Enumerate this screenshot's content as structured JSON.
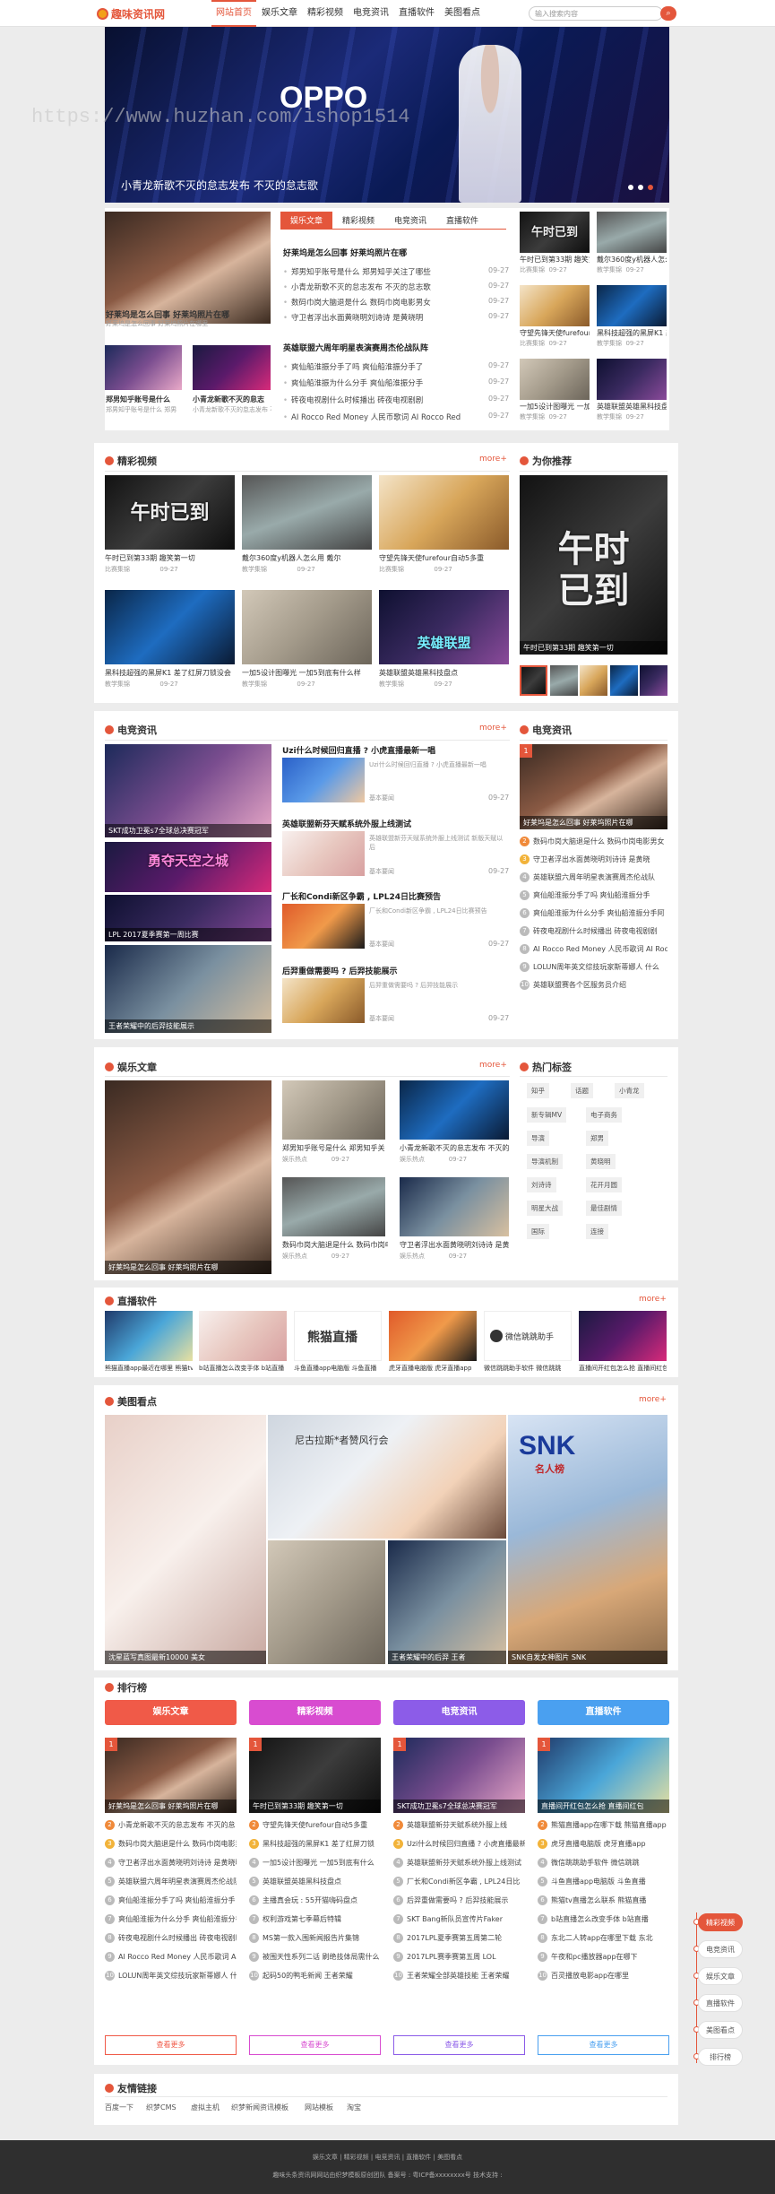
{
  "header": {
    "logo": "趣味资讯网",
    "nav": [
      "网站首页",
      "娱乐文章",
      "精彩视频",
      "电竞资讯",
      "直播软件",
      "美图看点"
    ],
    "search_placeholder": "输入搜索内容"
  },
  "banner": {
    "brand": "OPPO",
    "caption": "小青龙新歌不灭的怠志发布 不灭的怠志歌",
    "watermark": "https://www.huzhan.com/ishop1514"
  },
  "top": {
    "feature": {
      "caption": "好莱坞是怎么回事 好莱坞照片在哪",
      "sub": "好莱坞是怎么回事 好莱坞照片在哪里"
    },
    "small": [
      {
        "caption": "郑男知乎账号是什么",
        "sub": "郑男知乎账号是什么 郑男"
      },
      {
        "caption": "小青龙新歌不灭的怠志",
        "sub": "小青龙新歌不灭的怠志发布 不灭"
      }
    ],
    "tabs": [
      "娱乐文章",
      "精彩视频",
      "电竞资讯",
      "直播软件"
    ],
    "headline1": "好莱坞是怎么回事 好莱坞照片在哪",
    "list1": [
      {
        "t": "郑男知乎账号是什么 郑男知乎关注了哪些",
        "d": "09-27"
      },
      {
        "t": "小青龙新歌不灭的怠志发布 不灭的怠志歌",
        "d": "09-27"
      },
      {
        "t": "数码巾岗大脑退是什么 数码巾岗电影男女",
        "d": "09-27"
      },
      {
        "t": "守卫者浮出水面黄晓明刘诗诗 是黄晓明",
        "d": "09-27"
      }
    ],
    "headline2": "英雄联盟六周年明星表演赛周杰伦战队阵",
    "list2": [
      {
        "t": "爽仙船淮振分手了吗 爽仙船淮振分手了",
        "d": "09-27"
      },
      {
        "t": "爽仙船淮振为什么分手 爽仙船淮振分手",
        "d": "09-27"
      },
      {
        "t": "砖夜电视剧什么时候播出 砖夜电视剧剧",
        "d": "09-27"
      },
      {
        "t": "AI Rocco Red Money 人民币歌词 AI Rocco Red",
        "d": "09-27"
      }
    ],
    "right": [
      {
        "c": "午时已到第33期 趣笑第一",
        "m": "比赛集锦",
        "d": "09-27"
      },
      {
        "c": "戴尔360度y机器人怎么用",
        "m": "教学集锦",
        "d": "09-27"
      },
      {
        "c": "守望先锋天使furefour",
        "m": "比赛集锦",
        "d": "09-27"
      },
      {
        "c": "黑科技超强的黑屏K1 差了",
        "m": "教学集锦",
        "d": "09-27"
      },
      {
        "c": "一加5设计图曝光 一加5",
        "m": "教学集锦",
        "d": "09-27"
      },
      {
        "c": "英雄联盟英雄黑科技盘点",
        "m": "教学集锦",
        "d": "09-27"
      }
    ]
  },
  "videos": {
    "title": "精彩视频",
    "more": "more+",
    "items": [
      {
        "c": "午时已到第33期 趣笑第一切",
        "m": "比赛集锦",
        "d": "09-27"
      },
      {
        "c": "戴尔360度y机器人怎么用 戴尔",
        "m": "教学集锦",
        "d": "09-27"
      },
      {
        "c": "守望先锋天使furefour自动5多重",
        "m": "比赛集锦",
        "d": "09-27"
      },
      {
        "c": "黑科技超强的黑屏K1 差了红屏刀锁没会",
        "m": "教学集锦",
        "d": "09-27"
      },
      {
        "c": "一加5设计图曝光 一加5到底有什么样",
        "m": "教学集锦",
        "d": "09-27"
      },
      {
        "c": "英雄联盟英雄黑科技盘点",
        "m": "教学集锦",
        "d": "09-27"
      }
    ],
    "rec_title": "为你推荐",
    "rec_caption": "午时已到第33期 趣笑第一切"
  },
  "esports": {
    "title": "电竞资讯",
    "more": "more+",
    "items": [
      {
        "h": "Uzi什么时候回归直播 ? 小虎直播最新一唱",
        "s": "Uzi什么时候回归直播 ? 小虎直播最新一唱",
        "m": "基本要闻",
        "d": "09-27"
      },
      {
        "h": "英雄联盟新芬天赋系统外服上线测试",
        "s": "英雄联盟新芬天赋系统外服上线测试 新版天赋以后",
        "m": "基本要闻",
        "d": "09-27"
      },
      {
        "h": "厂长和Condi新区争霸 , LPL24日比赛预告",
        "s": "厂长和Condi新区争霸 , LPL24日比赛预告",
        "m": "基本要闻",
        "d": "09-27"
      },
      {
        "h": "后羿重做需要吗 ? 后羿技能展示",
        "s": "后羿重做需要吗 ? 后羿技能展示",
        "m": "基本要闻",
        "d": "09-27"
      }
    ],
    "left_caps": [
      "SKT成功卫冕s7全球总决赛冠军",
      "",
      "LPL 2017夏季赛第一周比赛",
      "王者荣耀中的后羿技能展示"
    ],
    "right_title": "电竞资讯",
    "right_caption": "好莱坞是怎么回事 好莱坞照片在哪",
    "rank": [
      "数码巾岗大脑退是什么 数码巾岗电影男女",
      "守卫者浮出水面黄晓明刘诗诗 是黄晓",
      "英雄联盟六周年明星表演赛周杰伦战队",
      "爽仙船淮振分手了吗 爽仙船淮振分手",
      "爽仙船淮振为什么分手 爽仙船淮振分手阿",
      "砖夜电视剧什么时候播出 砖夜电视剧剧",
      "AI Rocco Red Money 人民币歌词 AI Rocco",
      "LOLUN周年英文综技玩家斯蒂娜人 什么",
      "英雄联盟赛各个区服务员介绍"
    ]
  },
  "ent": {
    "title": "娱乐文章",
    "more": "more+",
    "feature": "好莱坞是怎么回事 好莱坞照片在哪",
    "items": [
      {
        "c": "郑男知乎账号是什么 郑男知乎关",
        "m": "娱乐热点",
        "d": "09-27"
      },
      {
        "c": "小青龙新歌不灭的怠志发布 不灭的",
        "m": "娱乐热点",
        "d": "09-27"
      },
      {
        "c": "数码巾岗大脑退是什么 数码巾岗电",
        "m": "娱乐热点",
        "d": "09-27"
      },
      {
        "c": "守卫者浮出水面黄晓明刘诗诗 是黄",
        "m": "娱乐热点",
        "d": "09-27"
      }
    ],
    "tags_title": "热门标签",
    "tags": [
      "知乎",
      "话题",
      "小青龙",
      "新专辑MV",
      "电子商务",
      "导演",
      "郑男",
      "导演机制",
      "黄晓明",
      "刘诗诗",
      "花开月圆",
      "明星大战",
      "最佳剧情",
      "国际",
      "连接"
    ]
  },
  "live": {
    "title": "直播软件",
    "more": "more+",
    "items": [
      "熊猫直播app最近在哪里 熊猫tv直播",
      "b站直播怎么改变手体 b站直播",
      "斗鱼直播app电脑版 斗鱼直播",
      "虎牙直播电脑版 虎牙直播app",
      "微信跳跳助手软件 微信跳跳",
      "直播间开红包怎么抢 直播间红包"
    ],
    "panda_label": "熊猫直播",
    "wx_label": "微信跳跳助手"
  },
  "photos": {
    "title": "美图看点",
    "more": "more+",
    "caps": [
      "沈星蓝写真图最新10000 美女",
      "",
      "王者荣耀中的后羿 王者",
      "SNK自发女神图片 SNK"
    ],
    "sign": "尼古拉斯*者赞风行会",
    "skt": "SNK",
    "skt2": "名人榜"
  },
  "rank": {
    "title": "排行榜",
    "cols": [
      {
        "h": "娱乐文章",
        "color": "#f05a48",
        "cap": "好莱坞是怎么回事 好莱坞照片在哪",
        "items": [
          "小青龙新歌不灭的怠志发布 不灭的怠",
          "数码巾岗大脑退是什么 数码巾岗电影男",
          "守卫者浮出水面黄晓明刘诗诗 是黄晓明",
          "英雄联盟六周年明星表演赛周杰伦战队",
          "爽仙船淮振分手了吗 爽仙船淮振分手",
          "爽仙船淮振为什么分手 爽仙船淮振分手",
          "砖夜电视剧什么时候播出 砖夜电视剧剧",
          "AI Rocco Red Money 人民币歌词 AI Rocco",
          "LOLUN周年英文综技玩家斯蒂娜人 什么"
        ]
      },
      {
        "h": "精彩视频",
        "color": "#d84cd0",
        "cap": "午时已到第33期 趣笑第一切",
        "items": [
          "守望先锋天使furefour自动5多重",
          "黑科技超强的黑屏K1 差了红屏刀锁",
          "一加5设计图曝光 一加5到底有什么",
          "英雄联盟英雄黑科技盘点",
          "主播真会玩 : 55开猫嗨码盘点",
          "权利游戏第七季幕后特辑",
          "MS第一款入围新闻报告片集锦",
          "被围天性系列二话 刷绝技体局需什么",
          "起码50的鸭毛新闻 王者荣耀"
        ]
      },
      {
        "h": "电竞资讯",
        "color": "#8c5ce8",
        "cap": "SKT成功卫冕s7全球总决赛冠军",
        "items": [
          "英雄联盟新芬天赋系统外服上线",
          "Uzi什么时候回归直播 ? 小虎直播最新",
          "英雄联盟新芬天赋系统外服上线测试",
          "厂长和Condi新区争霸 , LPL24日比",
          "后羿重做需要吗 ? 后羿技能展示",
          "SKT Bang新队员宣传片Faker",
          "2017LPL夏季赛第五周第二轮",
          "2017LPL赛季赛第五周 LOL",
          "王者荣耀全部英雄技能 王者荣耀"
        ]
      },
      {
        "h": "直播软件",
        "color": "#4aa0f0",
        "cap": "直播间开红包怎么抢 直播间红包",
        "items": [
          "熊猫直播app在哪下载 熊猫直播app",
          "虎牙直播电脑版 虎牙直播app",
          "微信跳跳助手软件 微信跳跳",
          "斗鱼直播app电脑版 斗鱼直播",
          "熊猫tv直播怎么联系 熊猫直播",
          "b站直播怎么改变手体 b站直播",
          "东北二人转app在哪里下载 东北",
          "午夜和pc播放器app在哪下",
          "百灵播放电影app在哪里"
        ]
      }
    ],
    "seemore": "查看更多"
  },
  "links": {
    "title": "友情链接",
    "items": [
      "百度一下",
      "织梦CMS",
      "虚拟主机",
      "织梦新闻资讯模板",
      "网站模板",
      "淘宝"
    ]
  },
  "floatnav": [
    "精彩视频",
    "电竞资讯",
    "娱乐文章",
    "直播软件",
    "美图看点",
    "排行榜"
  ],
  "footer": {
    "line1": "娱乐文章 | 精彩视频 | 电竞资讯 | 直播软件 | 美图看点",
    "line2": "趣味头条资讯网网站由织梦模板原创团队 备案号 : 粤ICP备xxxxxxxx号 技术支持 :"
  }
}
